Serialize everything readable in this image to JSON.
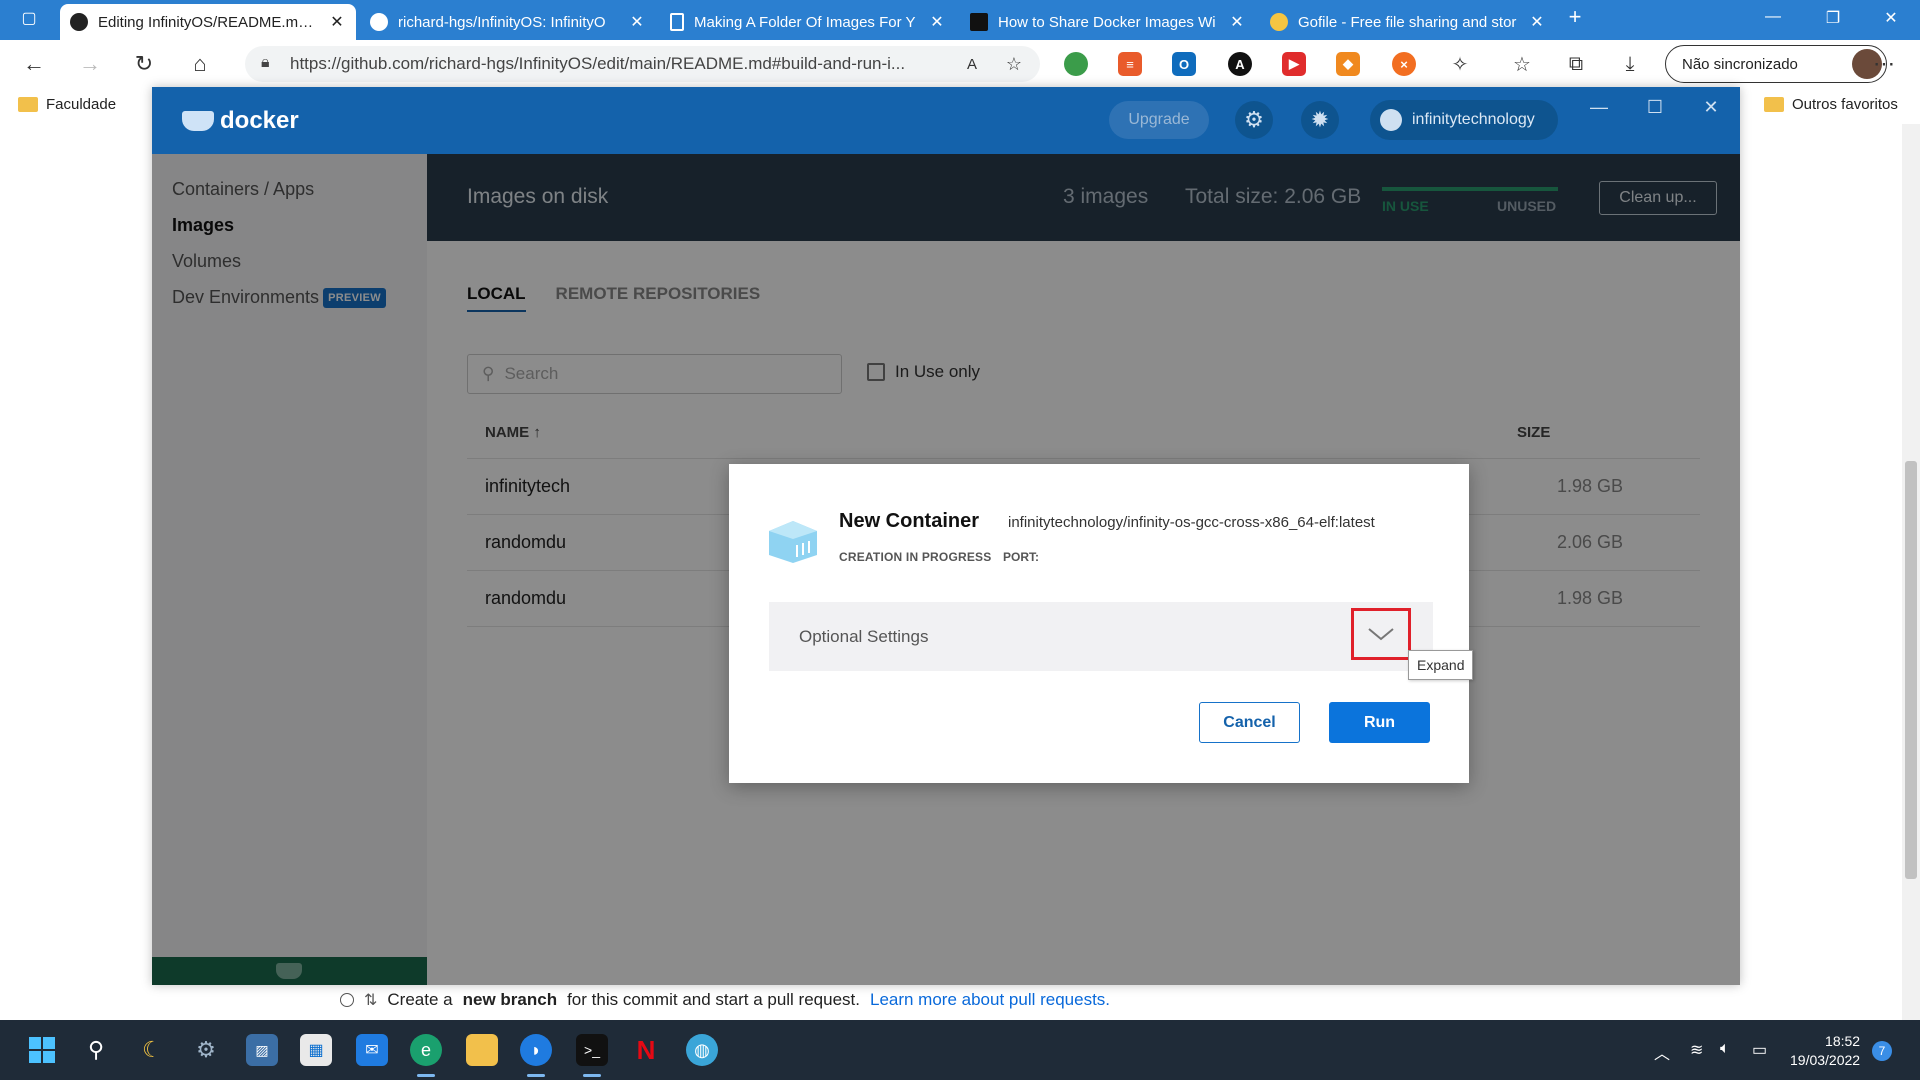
{
  "browser": {
    "tabs": [
      {
        "title": "Editing InfinityOS/README.md a",
        "favicon": "github-icon",
        "active": true
      },
      {
        "title": "richard-hgs/InfinityOS: InfinityO",
        "favicon": "github-icon",
        "active": false
      },
      {
        "title": "Making A Folder Of Images For Y",
        "favicon": "page-icon",
        "active": false
      },
      {
        "title": "How to Share Docker Images Wi",
        "favicon": "t-icon",
        "active": false
      },
      {
        "title": "Gofile - Free file sharing and stor",
        "favicon": "gofile-icon",
        "active": false
      }
    ],
    "url": "https://github.com/richard-hgs/InfinityOS/edit/main/README.md#build-and-run-i...",
    "sync_label": "Não sincronizado",
    "bookmarks": [
      "Faculdade"
    ],
    "other_favorites": "Outros favoritos"
  },
  "docker": {
    "logo": "docker",
    "upgrade": "Upgrade",
    "user": "infinitytechnology",
    "sidebar": {
      "items": [
        {
          "label": "Containers / Apps",
          "active": false
        },
        {
          "label": "Images",
          "active": true
        },
        {
          "label": "Volumes",
          "active": false
        },
        {
          "label": "Dev Environments",
          "active": false
        }
      ],
      "preview_badge": "PREVIEW"
    },
    "subheader": {
      "title": "Images on disk",
      "count": "3 images",
      "total": "Total size: 2.06 GB",
      "in_use": "IN USE",
      "unused": "UNUSED",
      "cleanup": "Clean up..."
    },
    "tabs": {
      "local": "LOCAL",
      "remote": "REMOTE REPOSITORIES"
    },
    "search_placeholder": "Search",
    "in_use_only": "In Use only",
    "columns": {
      "name": "NAME",
      "size": "SIZE"
    },
    "rows": [
      {
        "name": "infinitytech",
        "size": "1.98 GB"
      },
      {
        "name": "randomdu",
        "size": "2.06 GB"
      },
      {
        "name": "randomdu",
        "size": "1.98 GB"
      }
    ]
  },
  "modal": {
    "title": "New Container",
    "image": "infinitytechnology/infinity-os-gcc-cross-x86_64-elf:latest",
    "status": "CREATION IN PROGRESS",
    "port": "PORT:",
    "optional_settings": "Optional Settings",
    "tooltip": "Expand",
    "cancel": "Cancel",
    "run": "Run"
  },
  "github": {
    "footer_text_1": "Create a",
    "footer_bold": "new branch",
    "footer_text_2": "for this commit and start a pull request.",
    "footer_link": "Learn more about pull requests."
  },
  "taskbar": {
    "time": "18:52",
    "date": "19/03/2022",
    "notifications": "7"
  },
  "colors": {
    "docker_blue": "#1462ab",
    "subheader": "#2a3d4d",
    "run_button": "#0b74dc",
    "highlight": "#e0202a",
    "in_use": "#2a9d6f"
  }
}
